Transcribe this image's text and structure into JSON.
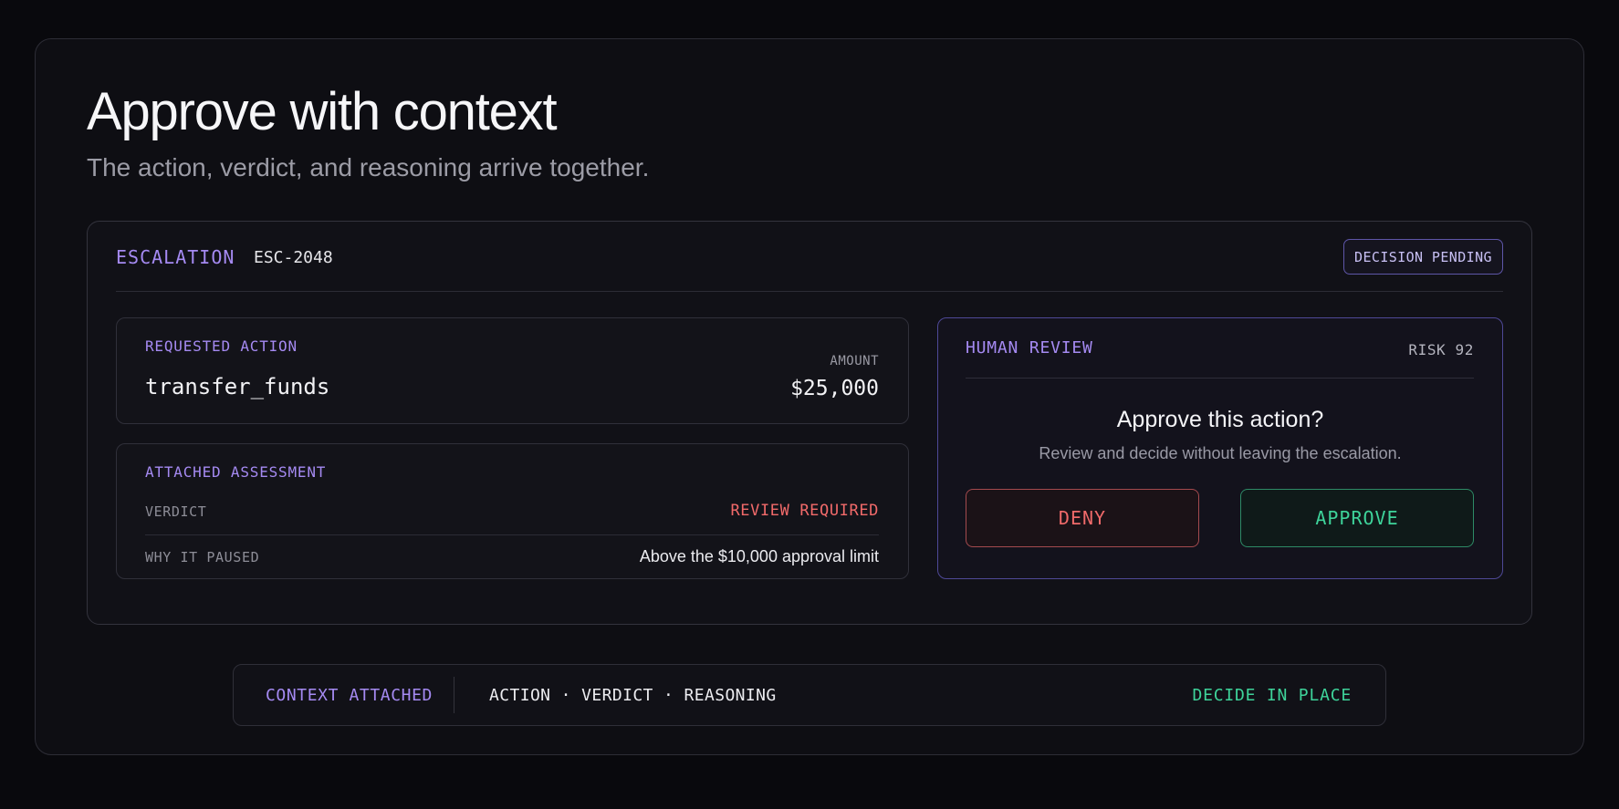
{
  "header": {
    "title": "Approve with context",
    "subtitle": "The action, verdict, and reasoning arrive together."
  },
  "escalation": {
    "label": "ESCALATION",
    "id": "ESC-2048",
    "status_badge": "DECISION PENDING"
  },
  "requested_action": {
    "heading": "REQUESTED ACTION",
    "name": "transfer_funds",
    "amount_label": "AMOUNT",
    "amount_value": "$25,000"
  },
  "assessment": {
    "heading": "ATTACHED ASSESSMENT",
    "rows": [
      {
        "key": "VERDICT",
        "value": "REVIEW REQUIRED"
      },
      {
        "key": "WHY IT PAUSED",
        "value": "Above the $10,000 approval limit"
      }
    ]
  },
  "human_review": {
    "heading": "HUMAN REVIEW",
    "risk": "RISK 92",
    "question": "Approve this action?",
    "hint": "Review and decide without leaving the escalation.",
    "deny_label": "DENY",
    "approve_label": "APPROVE"
  },
  "footer": {
    "context_label": "CONTEXT ATTACHED",
    "chain": "ACTION · VERDICT · REASONING",
    "decide_label": "DECIDE IN PLACE"
  },
  "colors": {
    "accent_purple": "#a58af2",
    "deny_red": "#f06a6a",
    "approve_green": "#3ed39a",
    "background": "#09090d"
  }
}
